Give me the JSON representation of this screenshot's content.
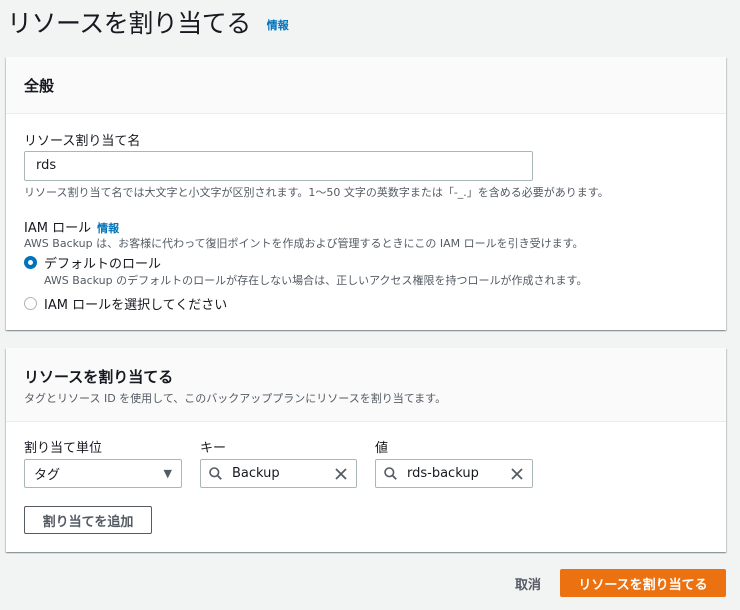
{
  "page": {
    "title": "リソースを割り当てる",
    "info_link": "情報"
  },
  "general": {
    "title": "全般",
    "assignment_name": {
      "label": "リソース割り当て名",
      "value": "rds",
      "hint": "リソース割り当て名では大文字と小文字が区別されます。1～50 文字の英数字または「-_.」を含める必要があります。"
    },
    "iam_role": {
      "label": "IAM ロール",
      "info_link": "情報",
      "description": "AWS Backup は、お客様に代わって復旧ポイントを作成および管理するときにこの IAM ロールを引き受けます。",
      "options": [
        {
          "label": "デフォルトのロール",
          "description": "AWS Backup のデフォルトのロールが存在しない場合は、正しいアクセス権限を持つロールが作成されます。",
          "checked": true
        },
        {
          "label": "IAM ロールを選択してください",
          "checked": false
        }
      ]
    }
  },
  "assign": {
    "title": "リソースを割り当てる",
    "description": "タグとリソース ID を使用して、このバックアッププランにリソースを割り当てます。",
    "columns": {
      "unit": "割り当て単位",
      "key": "キー",
      "value": "値"
    },
    "row": {
      "unit": "タグ",
      "key": "Backup",
      "value": "rds-backup"
    },
    "add_button": "割り当てを追加"
  },
  "footer": {
    "cancel": "取消",
    "submit": "リソースを割り当てる"
  },
  "colors": {
    "primary": "#ec7211",
    "link": "#0073bb",
    "background": "#f2f3f3"
  }
}
